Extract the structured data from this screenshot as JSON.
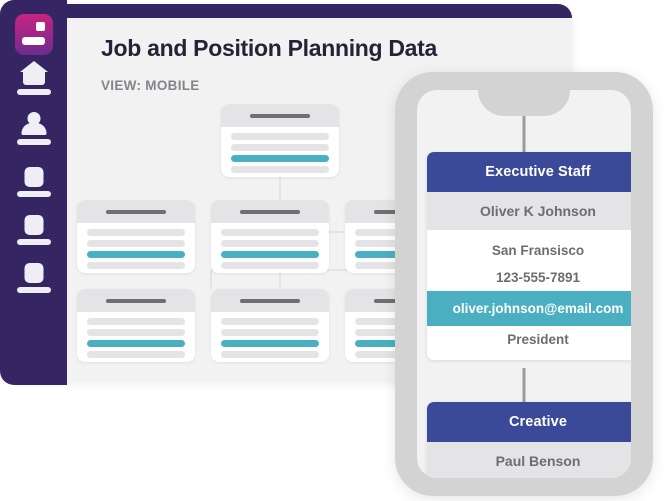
{
  "colors": {
    "sidebar_purple": "#362563",
    "active_gradient_start": "#c8247e",
    "active_gradient_end": "#6a2d90",
    "accent_teal": "#4ab0c1",
    "node_navy": "#3a4a99",
    "panel_gray": "#f2f2f3",
    "phone_frame": "#d3d3d4"
  },
  "sidebar": {
    "items": [
      {
        "name": "dashboard",
        "icon": "dashboard-tile-icon",
        "active": true
      },
      {
        "name": "upload",
        "icon": "upload-home-icon",
        "active": false
      },
      {
        "name": "people",
        "icon": "person-icon",
        "active": false
      },
      {
        "name": "reports",
        "icon": "square-document-icon",
        "active": false
      },
      {
        "name": "records",
        "icon": "square-document-icon",
        "active": false
      },
      {
        "name": "settings",
        "icon": "square-document-icon",
        "active": false
      }
    ]
  },
  "header": {
    "title": "Job and Position Planning Data",
    "view_label": "VIEW: MOBILE"
  },
  "org_chart": {
    "placeholder": true,
    "rows_per_card": 4,
    "accent_row_index": 2,
    "nodes": [
      {
        "level": 0,
        "index": 0
      },
      {
        "level": 1,
        "index": 0
      },
      {
        "level": 1,
        "index": 1
      },
      {
        "level": 1,
        "index": 2
      },
      {
        "level": 2,
        "index": 0
      },
      {
        "level": 2,
        "index": 1
      },
      {
        "level": 2,
        "index": 2
      }
    ]
  },
  "phone": {
    "nodes": [
      {
        "header": "Executive Staff",
        "name": "Oliver K Johnson",
        "lines": [
          {
            "text": "San Fransisco",
            "accent": false
          },
          {
            "text": "123-555-7891",
            "accent": false
          },
          {
            "text": "oliver.johnson@email.com",
            "accent": true
          },
          {
            "text": "President",
            "accent": false
          }
        ]
      },
      {
        "header": "Creative",
        "name": "Paul Benson",
        "lines": []
      }
    ]
  }
}
